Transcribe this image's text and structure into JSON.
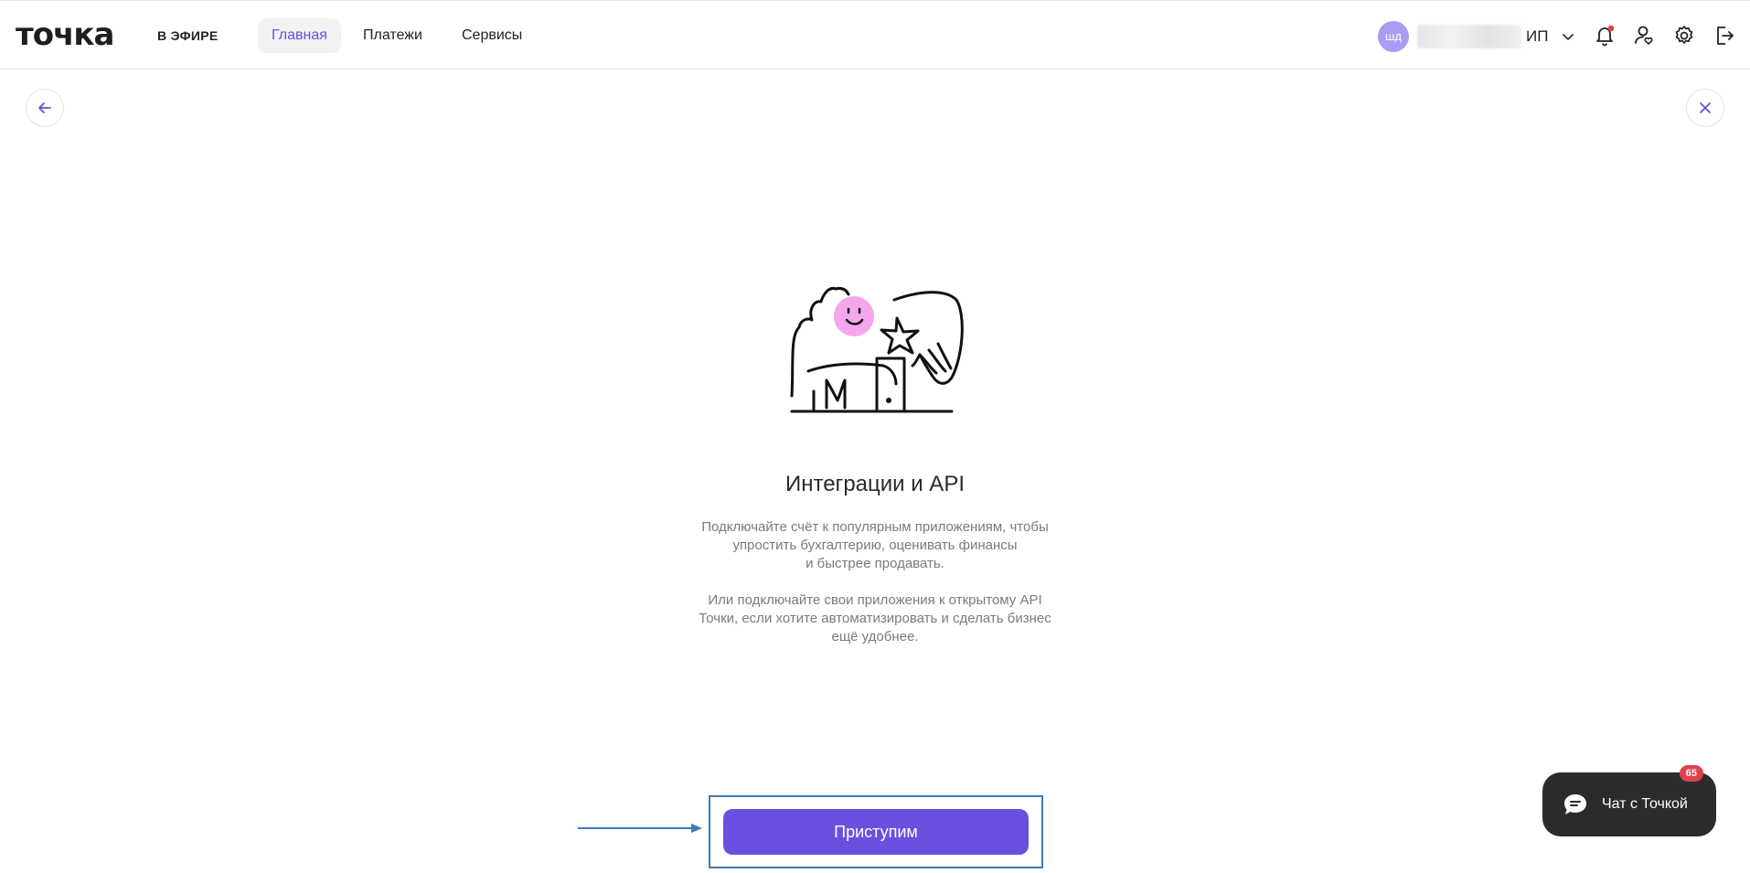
{
  "header": {
    "logo": "точка",
    "nav": {
      "efire": "В ЭФИРЕ",
      "home": "Главная",
      "payments": "Платежи",
      "services": "Сервисы"
    },
    "avatar_initials": "шд",
    "company_suffix": "ИП",
    "notification_dot_color": "#e0414b"
  },
  "main": {
    "title": "Интеграции и API",
    "paragraph1": "Подключайте счёт к популярным приложениям, чтобы\nупростить бухгалтерию, оценивать финансы\nи быстрее продавать.",
    "paragraph2": "Или подключайте свои приложения к открытому API\nТочки, если хотите автоматизировать и сделать бизнес\nещё удобнее.",
    "start_button": "Приступим"
  },
  "chat": {
    "label": "Чат с Точкой",
    "badge": "65"
  },
  "colors": {
    "accent": "#6b4fde",
    "highlight": "#3f7ab8",
    "chat_bg": "#2b2b2e"
  }
}
